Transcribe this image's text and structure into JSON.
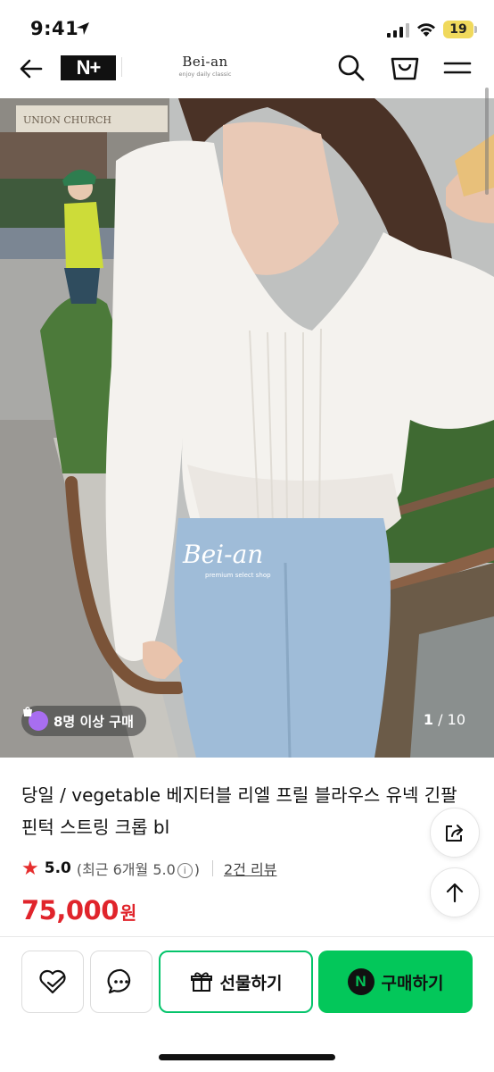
{
  "status_bar": {
    "time": "9:41",
    "battery": "19"
  },
  "header": {
    "nplus_logo": "N+",
    "brand_name": "Bei-an",
    "brand_tagline": "enjoy daily classic"
  },
  "gallery": {
    "watermark": "Bei-an",
    "watermark_sub": "premium select shop",
    "background_sign": "UNION CHURCH",
    "buyers_badge": "8명 이상 구매",
    "current_index": "1",
    "total": "10",
    "counter_separator": "/"
  },
  "product": {
    "title": "당일 / vegetable 베지터블 리엘 프릴 블라우스 유넥 긴팔 핀턱 스트링 크롭 bl",
    "rating": "5.0",
    "rating_recent_prefix": "(최근 6개월 5.0",
    "rating_recent_suffix": ")",
    "info_icon_glyph": "i",
    "review_link": "2건 리뷰",
    "price": "75,000",
    "price_unit": "원"
  },
  "bottom_bar": {
    "gift_label": "선물하기",
    "buy_label": "구매하기",
    "npay_glyph": "N"
  },
  "colors": {
    "price": "#e0242b",
    "primary_green": "#03c75a",
    "star": "#e62e2e",
    "badge_icon": "#a86ef0",
    "battery": "#f0d95c"
  },
  "icons": {
    "back": "arrow-left-icon",
    "search": "search-icon",
    "cart": "shopping-bag-icon",
    "menu": "hamburger-menu-icon",
    "share": "share-icon",
    "top": "arrow-up-icon",
    "wish": "heart-icon",
    "chat": "chat-bubble-icon",
    "gift": "gift-icon"
  }
}
